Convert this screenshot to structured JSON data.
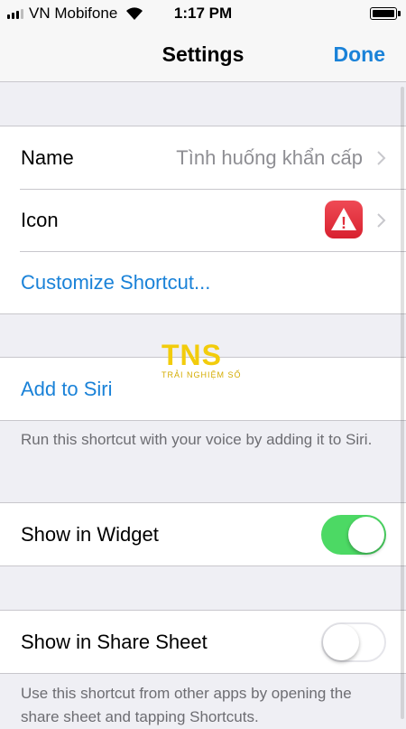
{
  "status_bar": {
    "carrier": "VN Mobifone",
    "time": "1:17 PM"
  },
  "nav": {
    "title": "Settings",
    "done_label": "Done"
  },
  "settings_group": {
    "name_label": "Name",
    "name_value": "Tình huống khẩn cấp",
    "icon_label": "Icon",
    "icon_glyph": "!",
    "customize_label": "Customize Shortcut..."
  },
  "siri_group": {
    "add_to_siri_label": "Add to Siri",
    "footer": "Run this shortcut with your voice by adding it to Siri."
  },
  "widget_group": {
    "label": "Show in Widget",
    "enabled": true
  },
  "share_group": {
    "label": "Show in Share Sheet",
    "enabled": false,
    "footer": "Use this shortcut from other apps by opening the share sheet and tapping Shortcuts."
  },
  "watermark": {
    "logo": "TNS",
    "subtitle": "TRẢI NGHIỆM SỐ"
  },
  "colors": {
    "accent": "#1a82d8",
    "toggle_on": "#4cd964",
    "icon_bg": "#e0303c"
  },
  "icons": {
    "signal": "cellular-signal-icon",
    "wifi": "wifi-icon",
    "battery": "battery-icon",
    "chevron": "chevron-right-icon",
    "warning": "warning-icon"
  }
}
